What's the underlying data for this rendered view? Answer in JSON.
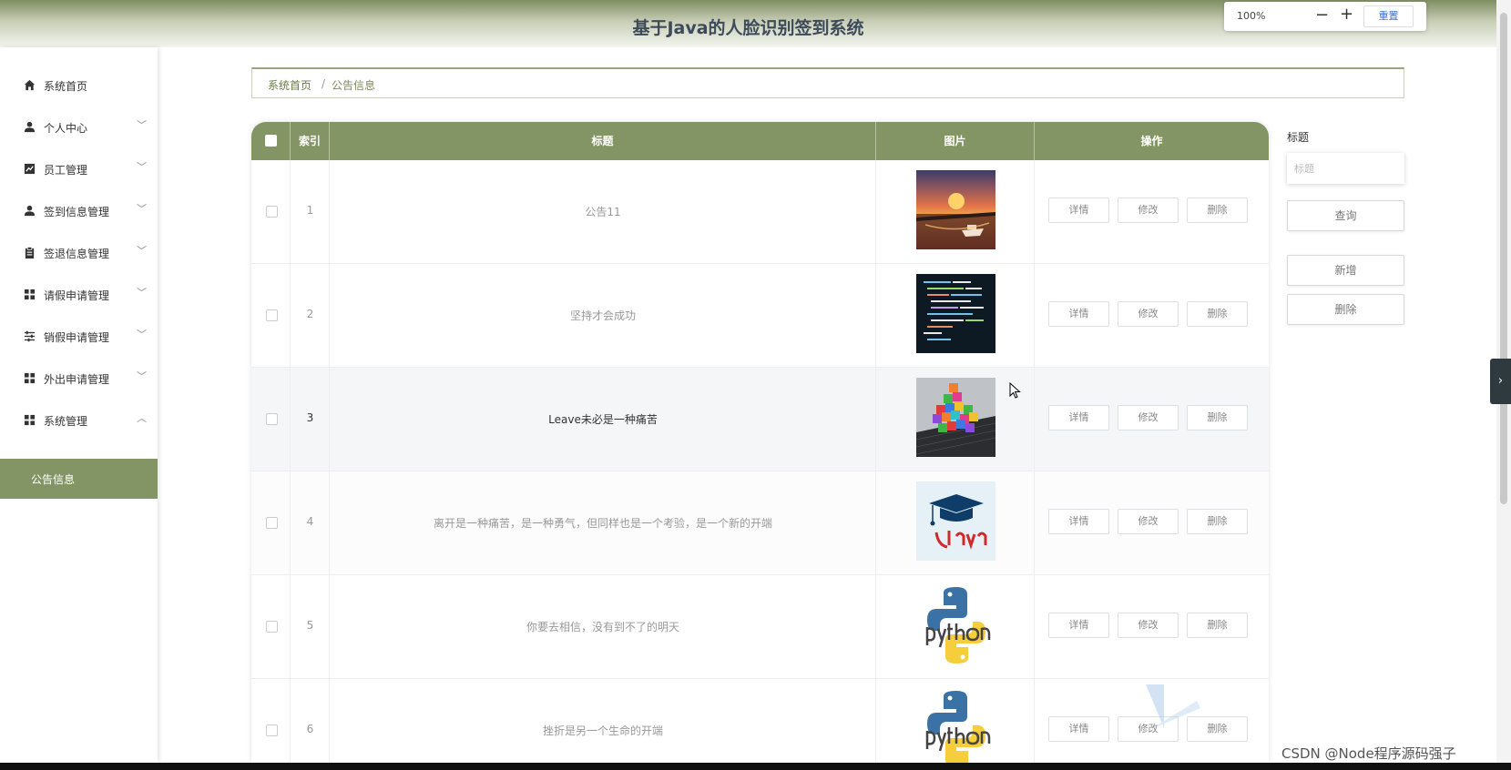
{
  "header": {
    "title": "基于Java的人脸识别签到系统"
  },
  "zoom": {
    "value": "100%",
    "minus": "−",
    "plus": "+",
    "reset": "重置"
  },
  "sidebar": {
    "items": [
      {
        "label": "系统首页",
        "icon": "home-icon",
        "chevron": ""
      },
      {
        "label": "个人中心",
        "icon": "user-icon",
        "chevron": "﹀"
      },
      {
        "label": "员工管理",
        "icon": "chart-icon",
        "chevron": "﹀"
      },
      {
        "label": "签到信息管理",
        "icon": "user-icon",
        "chevron": "﹀"
      },
      {
        "label": "签退信息管理",
        "icon": "clipboard-icon",
        "chevron": "﹀"
      },
      {
        "label": "请假申请管理",
        "icon": "grid-icon",
        "chevron": "﹀"
      },
      {
        "label": "销假申请管理",
        "icon": "sliders-icon",
        "chevron": "﹀"
      },
      {
        "label": "外出申请管理",
        "icon": "grid-icon",
        "chevron": "﹀"
      },
      {
        "label": "系统管理",
        "icon": "grid-icon",
        "chevron": "︿"
      }
    ],
    "sub_active": "公告信息"
  },
  "breadcrumb": {
    "home": "系统首页",
    "separator": "/",
    "current": "公告信息"
  },
  "table": {
    "headers": {
      "index": "索引",
      "title": "标题",
      "image": "图片",
      "actions": "操作"
    },
    "action_labels": {
      "detail": "详情",
      "edit": "修改",
      "delete": "删除"
    },
    "rows": [
      {
        "index": "1",
        "title": "公告11",
        "image": "sunset-boat-image"
      },
      {
        "index": "2",
        "title": "坚持才会成功",
        "image": "code-screen-image"
      },
      {
        "index": "3",
        "title": "Leave未必是一种痛苦",
        "image": "colorful-cubes-keyboard-image"
      },
      {
        "index": "4",
        "title": "离开是一种痛苦，是一种勇气，但同样也是一个考验，是一个新的开端",
        "image": "java-logo-image"
      },
      {
        "index": "5",
        "title": "你要去相信，没有到不了的明天",
        "image": "python-logo-image"
      },
      {
        "index": "6",
        "title": "挫折是另一个生命的开端",
        "image": "python-logo-image"
      }
    ]
  },
  "search": {
    "label": "标题",
    "placeholder": "标题",
    "query": "查询",
    "add": "新增",
    "delete": "删除"
  },
  "watermark": "CSDN @Node程序源码强子",
  "colors": {
    "accent": "#849565",
    "header_dark": "#7f8e62",
    "title_text": "#3c4a5a"
  }
}
